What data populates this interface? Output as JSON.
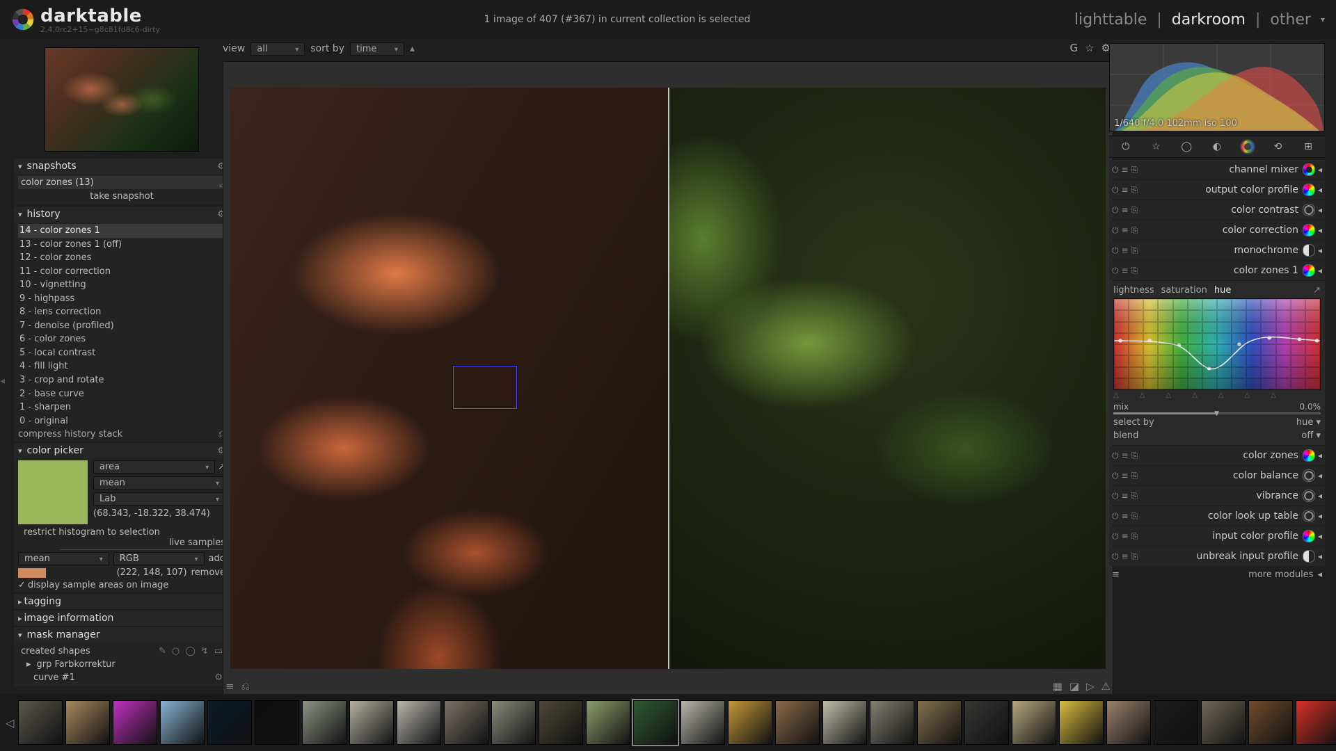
{
  "app": {
    "name": "darktable",
    "version": "2.4.0rc2+15~g8c81fd8c6-dirty"
  },
  "status": "1 image of 407 (#367) in current collection is selected",
  "views": {
    "lighttable": "lighttable",
    "darkroom": "darkroom",
    "other": "other"
  },
  "secondbar": {
    "view_label": "view",
    "view_val": "all",
    "sort_label": "sort by",
    "sort_val": "time"
  },
  "left": {
    "snapshots": {
      "title": "snapshots",
      "entry": "color zones (13)",
      "take": "take snapshot"
    },
    "history": {
      "title": "history",
      "items": [
        "14 - color zones 1",
        "13 - color zones 1 (off)",
        "12 - color zones",
        "11 - color correction",
        "10 - vignetting",
        "9 - highpass",
        "8 - lens correction",
        "7 - denoise (profiled)",
        "6 - color zones",
        "5 - local contrast",
        "4 - fill light",
        "3 - crop and rotate",
        "2 - base curve",
        "1 - sharpen",
        "0 - original"
      ],
      "compress": "compress history stack"
    },
    "colorpicker": {
      "title": "color picker",
      "mode": "area",
      "stat": "mean",
      "space": "Lab",
      "value": "(68.343, -18.322, 38.474)",
      "restrict": "restrict histogram to selection",
      "live": "live samples",
      "mean2": "mean",
      "rgb": "RGB",
      "add": "add",
      "rgbval": "(222, 148, 107)",
      "remove": "remove",
      "display": "display sample areas on image"
    },
    "tagging": "tagging",
    "imageinfo": "image information",
    "maskmgr": {
      "title": "mask manager",
      "created": "created shapes",
      "grp": "grp Farbkorrektur",
      "curve": "curve #1"
    }
  },
  "right": {
    "exif": "1/640 f/4.0 102mm iso 100",
    "modules": [
      {
        "label": "channel mixer",
        "dot": "ring"
      },
      {
        "label": "output color profile",
        "dot": "cz"
      },
      {
        "label": "color contrast",
        "dot": "ring2"
      },
      {
        "label": "color correction",
        "dot": "cz"
      },
      {
        "label": "monochrome",
        "dot": "half"
      },
      {
        "label": "color zones 1",
        "dot": "cz"
      }
    ],
    "cz": {
      "tabs": {
        "l": "lightness",
        "s": "saturation",
        "h": "hue"
      },
      "mix_l": "mix",
      "mix_v": "0.0%",
      "sel_l": "select by",
      "sel_v": "hue",
      "blend_l": "blend",
      "blend_v": "off"
    },
    "modules2": [
      {
        "label": "color zones",
        "dot": "cz"
      },
      {
        "label": "color balance",
        "dot": "ring2"
      },
      {
        "label": "vibrance",
        "dot": "ring2"
      },
      {
        "label": "color look up table",
        "dot": "ring2"
      },
      {
        "label": "input color profile",
        "dot": "cz"
      },
      {
        "label": "unbreak input profile",
        "dot": "half"
      }
    ],
    "more": "more modules"
  },
  "filmstrip_colors": [
    "#5b584e",
    "#a88860",
    "#c030c0",
    "#87b4d4",
    "#0b1a2a",
    "#0e0e0e",
    "#8c9484",
    "#b4b0a2",
    "#b8b6ae",
    "#7a7266",
    "#8a8c7c",
    "#4e4836",
    "#8e9e6c",
    "#2e5a30",
    "#b8b6aa",
    "#c49838",
    "#8a6a4a",
    "#c0bda8",
    "#838072",
    "#82704c",
    "#363634",
    "#b8a880",
    "#d8bc40",
    "#9a826a",
    "#1c1c1c",
    "#706858",
    "#704c2c",
    "#d83028",
    "#a8700c"
  ]
}
